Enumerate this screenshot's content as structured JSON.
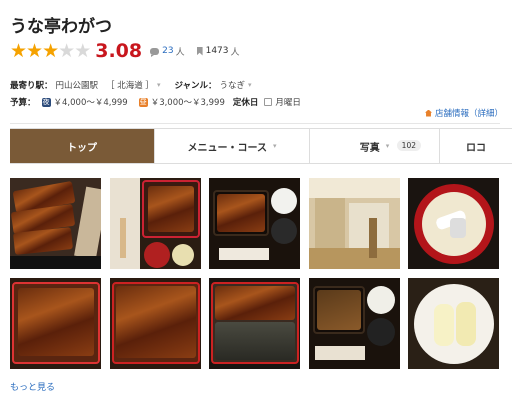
{
  "restaurant": {
    "name": "うな亭わがつ",
    "rating": 3.08,
    "rating_fraction": 0.616,
    "review_count": "23",
    "review_unit": "人",
    "bookmark_count": "1473",
    "bookmark_unit": "人"
  },
  "info": {
    "station_label": "最寄り駅：",
    "station": "円山公園駅",
    "area": "［ 北海道 ］",
    "genre_label": "ジャンル：",
    "genre": "うなぎ",
    "budget_label": "予算：",
    "dinner_badge": "夜",
    "dinner_price": "￥4,000～￥4,999",
    "lunch_badge": "昼",
    "lunch_price": "￥3,000～￥3,999",
    "holiday_label": "定休日",
    "holiday": "月曜日",
    "detail_link": "店舗情報（詳細）"
  },
  "tabs": [
    {
      "label": "トップ",
      "active": true
    },
    {
      "label": "メニュー・コース",
      "active": false
    },
    {
      "label": "写真",
      "count": "102",
      "active": false
    },
    {
      "label": "ロコ",
      "active": false
    }
  ],
  "photos_more": "もっと見る",
  "colors": {
    "accent_brown": "#7a5a37",
    "score_red": "#c8161d",
    "star_gold": "#f5a200",
    "link_blue": "#2b6dbf"
  }
}
